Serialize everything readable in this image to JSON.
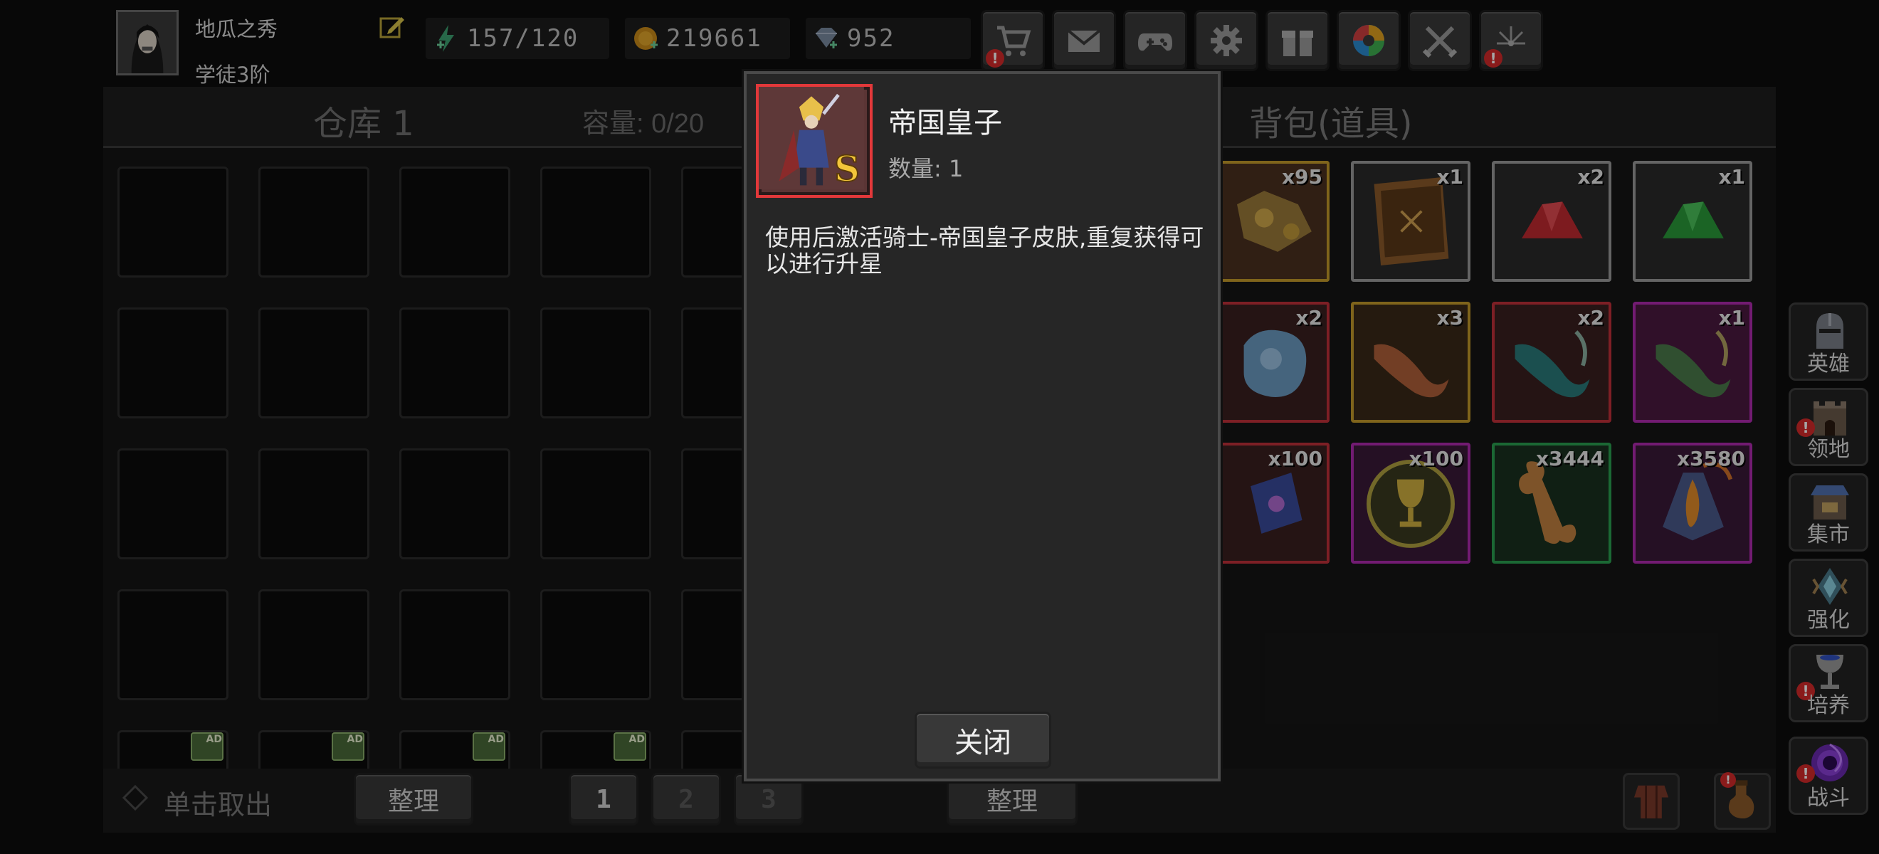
{
  "player": {
    "name": "地瓜之秀",
    "rank": "学徒3阶"
  },
  "resources": {
    "energy": "157/120",
    "gold": "219661",
    "gems": "952"
  },
  "toolbar": [
    {
      "name": "shop-cart-icon",
      "alert": "!"
    },
    {
      "name": "mail-icon",
      "alert": ""
    },
    {
      "name": "gamepad-icon",
      "alert": ""
    },
    {
      "name": "settings-gear-icon",
      "alert": ""
    },
    {
      "name": "gift-icon",
      "alert": ""
    },
    {
      "name": "color-wheel-icon",
      "alert": ""
    },
    {
      "name": "crossed-swords-icon",
      "alert": ""
    },
    {
      "name": "fireworks-icon",
      "alert": "!"
    }
  ],
  "warehouse": {
    "title": "仓库 1",
    "capacity": "容量: 0/20",
    "take_out_hint": "单击取出",
    "sort_label": "整理",
    "pages": [
      "1",
      "2",
      "3"
    ],
    "ad_badge": "AD"
  },
  "backpack": {
    "title": "背包(道具)",
    "sort_label": "整理",
    "items": [
      {
        "name": "gold-ore-item",
        "count": "x95",
        "rarity": "#c49a2a"
      },
      {
        "name": "spell-book-item",
        "count": "x1",
        "rarity": "#9a9a9a"
      },
      {
        "name": "red-crystal-item",
        "count": "x2",
        "rarity": "#9a9a9a"
      },
      {
        "name": "green-crystal-item",
        "count": "x1",
        "rarity": "#9a9a9a"
      },
      {
        "name": "blue-slime-item",
        "count": "x2",
        "rarity": "#c0303a"
      },
      {
        "name": "orange-horn-item",
        "count": "x3",
        "rarity": "#c49a2a"
      },
      {
        "name": "teal-horn-item",
        "count": "x2",
        "rarity": "#c0303a"
      },
      {
        "name": "green-horn-item",
        "count": "x1",
        "rarity": "#b02ab0"
      },
      {
        "name": "rune-stone-item",
        "count": "x100",
        "rarity": "#c0303a"
      },
      {
        "name": "trophy-medal-item",
        "count": "x100",
        "rarity": "#b02ab0"
      },
      {
        "name": "bone-item",
        "count": "x3444",
        "rarity": "#2aa050"
      },
      {
        "name": "fire-crystal-item",
        "count": "x3580",
        "rarity": "#b02ab0"
      }
    ]
  },
  "side_nav": [
    {
      "label": "英雄",
      "alert": ""
    },
    {
      "label": "领地",
      "alert": "!"
    },
    {
      "label": "集市",
      "alert": ""
    },
    {
      "label": "强化",
      "alert": ""
    },
    {
      "label": "培养",
      "alert": "!"
    },
    {
      "label": "战斗",
      "alert": "!"
    }
  ],
  "dialog": {
    "item_name": "帝国皇子",
    "quantity": "数量: 1",
    "description": "使用后激活骑士-帝国皇子皮肤,重复获得可以进行升星",
    "grade": "S",
    "close_label": "关闭"
  },
  "colors": {
    "dialog_border_red": "#e2383a",
    "alert_red": "#d42a2a"
  }
}
